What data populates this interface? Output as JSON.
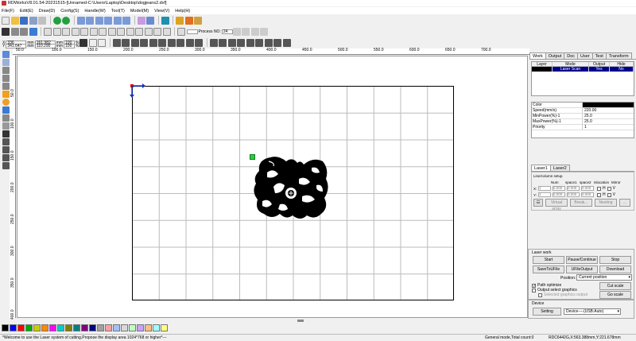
{
  "window": {
    "title": "RDWorksV8.01.54-20231515-[Unnamed-C:\\Users\\Laptop\\Desktop\\dogjeans2.dxf]"
  },
  "menu": [
    "File(F)",
    "Edit(E)",
    "Draw(D)",
    "Config(S)",
    "Handle(W)",
    "Tool(T)",
    "Model(M)",
    "View(V)",
    "Help(H)"
  ],
  "toolbar": {
    "pos_x": "336",
    "pos_y": "341.647",
    "size_w": "161.982",
    "size_h": "110.290",
    "unit": "mm",
    "pct_w": "100",
    "pct_h": "100",
    "pct_unit": "%",
    "process_label": "Process NO:",
    "process_no": "24"
  },
  "ruler_top": [
    "50.0",
    "100.0",
    "150.0",
    "200.0",
    "250.0",
    "300.0",
    "350.0",
    "400.0",
    "450.0",
    "500.0",
    "550.0",
    "600.0",
    "650.0",
    "700.0"
  ],
  "ruler_left": [
    "50.0",
    "100.0",
    "150.0",
    "200.0",
    "250.0",
    "300.0",
    "350.0",
    "400.0"
  ],
  "colors": {
    "palette": [
      "#000000",
      "#0000ff",
      "#ff0000",
      "#00aa00",
      "#cccc00",
      "#ff8800",
      "#ff00ff",
      "#00cccc",
      "#808000",
      "#008080",
      "#800080",
      "#000080",
      "#a0a0a0",
      "#ffa0a0",
      "#a0c0ff",
      "#d8d8d8",
      "#c0ffc0",
      "#c8a0ff",
      "#ffc080",
      "#a0ffff",
      "#ffff80"
    ],
    "selected_layer": "#00008b"
  },
  "right_panel": {
    "tabs": [
      "Work",
      "Output",
      "Doc",
      "User",
      "Test",
      "Transform"
    ],
    "layer_table": {
      "headers": [
        "Layer",
        "Mode",
        "Output",
        "Hide"
      ],
      "rows": [
        {
          "layer": "",
          "mode": "Laser Scan",
          "output": "Yes",
          "hide": "No"
        }
      ]
    },
    "params": [
      {
        "k": "Color",
        "v": ""
      },
      {
        "k": "Speed(mm/s)",
        "v": "220.00"
      },
      {
        "k": "MinPower(%)-1",
        "v": "25.0"
      },
      {
        "k": "MaxPower(%)-1",
        "v": "25.0"
      },
      {
        "k": "Priority",
        "v": "1"
      }
    ],
    "laser_tabs": [
      "Laser1",
      "Laser2"
    ],
    "array": {
      "title": "Line/column setup",
      "headers": [
        "Num",
        "space1",
        "space2",
        "Islocation",
        "Mirror"
      ],
      "x_label": "X:",
      "y_label": "Y:",
      "x_vals": [
        "1",
        "0.000",
        "0.000",
        "0.000"
      ],
      "y_vals": [
        "1",
        "0.000",
        "0.000",
        "0.000"
      ],
      "mirror_h": "H",
      "mirror_v": "V",
      "btn_virtual": "Virtual array",
      "btn_break": "Break...",
      "btn_nesting": "Nesting",
      "btn_more": "..."
    },
    "laser_work": {
      "title": "Laser work",
      "start": "Start",
      "pause": "Pause/Continue",
      "stop": "Stop",
      "save_to_file": "SaveToUFile",
      "ufile_output": "UFileOutput",
      "download": "Download",
      "position_label": "Position:",
      "position_value": "Current position",
      "path_optimize": "Path optimize",
      "output_select": "Output select graphics",
      "selected_graphics": "Selected graphics output",
      "cut_scale": "Cut scale",
      "go_scale": "Go scale"
    },
    "device": {
      "title": "Device",
      "setting": "Setting",
      "device_value": "Device----(USB:Auto)"
    }
  },
  "status": {
    "message": "*Welcome to use the Laser system of cutting,Propose the display area 1024*768 or higher*---",
    "mode": "General mode,Total count:0",
    "board": "RDC6442G,X:563.388mm,Y:221.678mm"
  }
}
